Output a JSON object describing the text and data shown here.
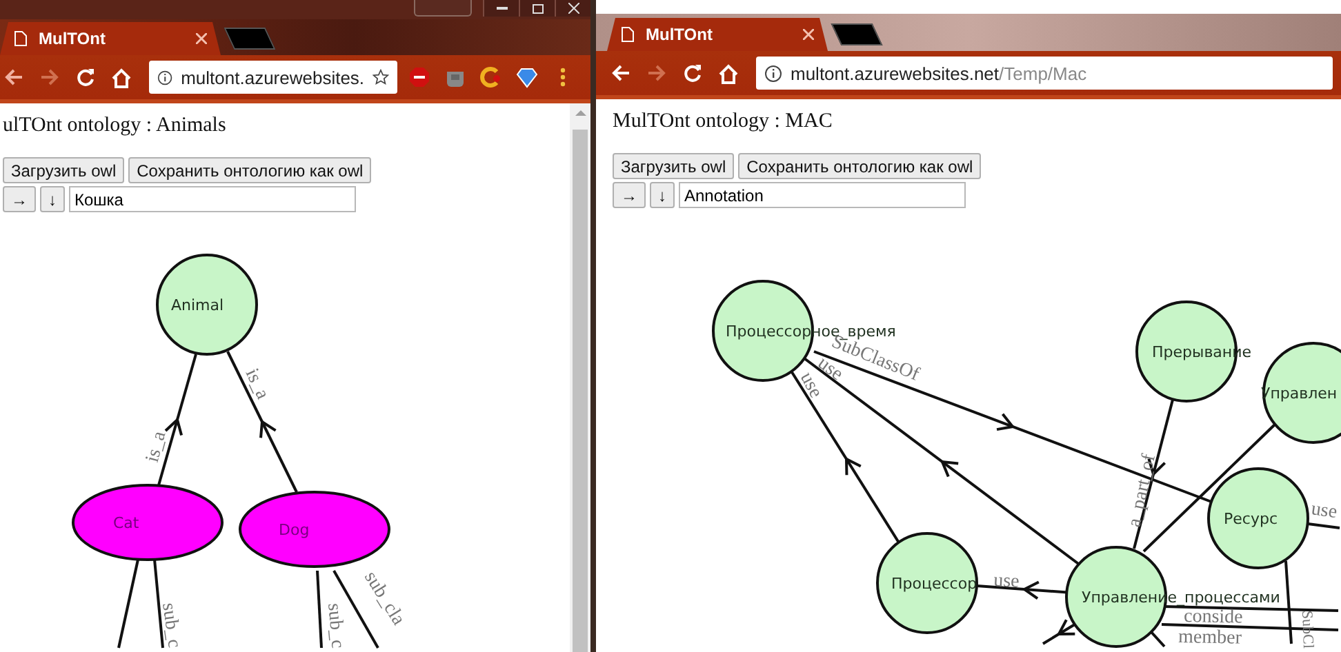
{
  "windows": [
    {
      "kind": "compact",
      "tab": {
        "title": "MulTOnt",
        "selected": true
      },
      "address": {
        "host": "multont.azurewebsites."
      },
      "page": {
        "title": "ulTOnt ontology : Animals",
        "buttons": [
          "Загрузить owl",
          "Сохранить онтологию как owl"
        ],
        "nav_buttons": [
          "→",
          "↓"
        ],
        "search": {
          "value": "Кошка"
        }
      },
      "graph": {
        "nodes": [
          {
            "label": "Animal",
            "kind": "class"
          },
          {
            "label": "Cat",
            "kind": "individual"
          },
          {
            "label": "Dog",
            "kind": "individual"
          }
        ],
        "edges": [
          {
            "label": "is_a",
            "arrow": true
          },
          {
            "label": "is_a",
            "arrow": true
          },
          {
            "arrow": false
          },
          {
            "label": "sub_c",
            "arrow": false
          },
          {
            "label": "sub_c",
            "arrow": false
          },
          {
            "label": "sub_cla",
            "arrow": false
          }
        ]
      }
    },
    {
      "kind": "wide",
      "tab": {
        "title": "MulTOnt",
        "selected": true
      },
      "address": {
        "host": "multont.azurewebsites.net",
        "path": "/Temp/Mac"
      },
      "page": {
        "title": "MulTOnt ontology : MAC",
        "buttons": [
          "Загрузить owl",
          "Сохранить онтологию как owl"
        ],
        "nav_buttons": [
          "→",
          "↓"
        ],
        "search": {
          "value": "Annotation"
        }
      },
      "graph": {
        "nodes": [
          {
            "label": "Процессорное_время",
            "kind": "class"
          },
          {
            "label": "Прерывание",
            "kind": "class"
          },
          {
            "label": "Управлен",
            "kind": "class"
          },
          {
            "label": "Ресурс",
            "kind": "class"
          },
          {
            "label": "Процессор",
            "kind": "class"
          },
          {
            "label": "Управление_процессами",
            "kind": "class"
          }
        ],
        "edges": [
          {
            "label": "SubClassOf",
            "arrow": true
          },
          {
            "label": "use",
            "arrow": true
          },
          {
            "label": "use",
            "arrow": true
          },
          {
            "label": "a_part_of",
            "arrow": true
          },
          {
            "arrow": false
          },
          {
            "label": "use",
            "arrow": true
          },
          {
            "label": "use",
            "arrow": false
          },
          {
            "label": "SubCl",
            "arrow": false
          },
          {
            "label": "conside",
            "arrow": false
          },
          {
            "label": "member",
            "arrow": false
          },
          {
            "arrow": true
          },
          {
            "arrow": false
          }
        ]
      }
    }
  ]
}
